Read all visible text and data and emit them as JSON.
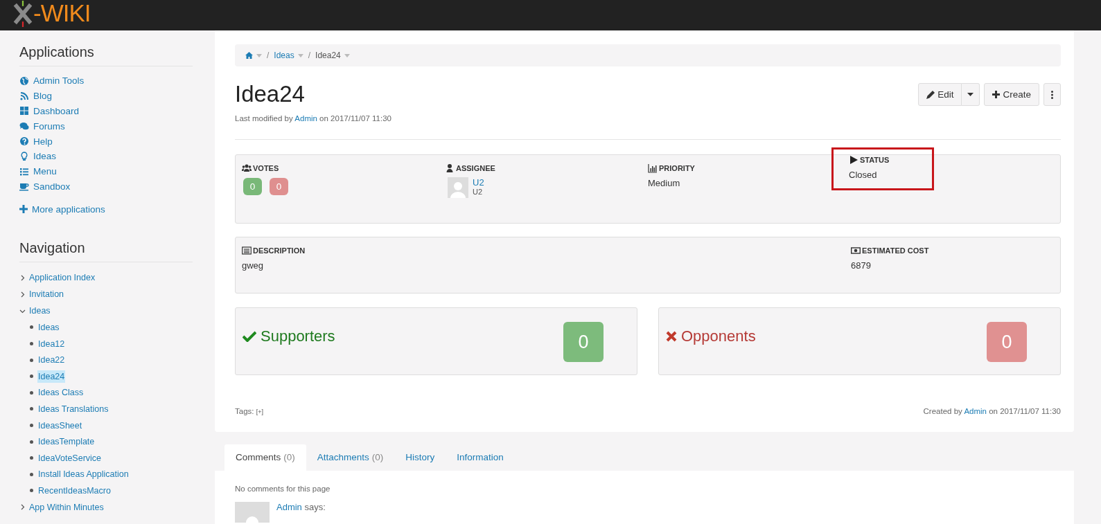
{
  "logo": {
    "text": "-WIKI"
  },
  "sidebar": {
    "applications": {
      "title": "Applications",
      "items": [
        {
          "label": "Admin Tools"
        },
        {
          "label": "Blog"
        },
        {
          "label": "Dashboard"
        },
        {
          "label": "Forums"
        },
        {
          "label": "Help"
        },
        {
          "label": "Ideas"
        },
        {
          "label": "Menu"
        },
        {
          "label": "Sandbox"
        }
      ],
      "more": "More applications"
    },
    "navigation": {
      "title": "Navigation",
      "items": [
        {
          "label": "Application Index",
          "expanded": false
        },
        {
          "label": "Invitation",
          "expanded": false
        },
        {
          "label": "Ideas",
          "expanded": true,
          "children": [
            {
              "label": "Ideas",
              "selected": false
            },
            {
              "label": "Idea12",
              "selected": false
            },
            {
              "label": "Idea22",
              "selected": false
            },
            {
              "label": "Idea24",
              "selected": true
            },
            {
              "label": "Ideas Class",
              "selected": false
            },
            {
              "label": "Ideas Translations",
              "selected": false
            },
            {
              "label": "IdeasSheet",
              "selected": false
            },
            {
              "label": "IdeasTemplate",
              "selected": false
            },
            {
              "label": "IdeaVoteService",
              "selected": false
            },
            {
              "label": "Install Ideas Application",
              "selected": false
            },
            {
              "label": "RecentIdeasMacro",
              "selected": false
            }
          ]
        },
        {
          "label": "App Within Minutes",
          "expanded": false
        }
      ]
    }
  },
  "breadcrumb": [
    {
      "separator": "/",
      "label": "Ideas",
      "kind": "link"
    },
    {
      "separator": "/",
      "label": "Idea24",
      "kind": "current"
    }
  ],
  "title": "Idea24",
  "modified": {
    "prefix": "Last modified by",
    "user": "Admin",
    "suffix": "on 2017/11/07 11:30"
  },
  "actions": {
    "edit": "Edit",
    "create": "Create"
  },
  "fields": [
    {
      "label": "VOTES",
      "kind": "votes",
      "up": "0",
      "down": "0",
      "highlighted": false
    },
    {
      "label": "ASSIGNEE",
      "kind": "user",
      "value": "U2",
      "sub": "U2",
      "highlighted": false
    },
    {
      "label": "PRIORITY",
      "kind": "text",
      "value": "Medium",
      "highlighted": false
    },
    {
      "label": "STATUS",
      "kind": "text",
      "value": "Closed",
      "highlighted": true
    }
  ],
  "details": [
    {
      "label": "DESCRIPTION",
      "kind": "wide",
      "value": "gweg"
    },
    {
      "label": "ESTIMATED COST",
      "kind": "narrow",
      "value": "6879"
    }
  ],
  "tallies": [
    {
      "label": "Supporters",
      "kind": "support",
      "count": "0"
    },
    {
      "label": "Opponents",
      "kind": "oppose",
      "count": "0"
    }
  ],
  "tags": {
    "label": "Tags:",
    "add": "[+]"
  },
  "created": {
    "prefix": "Created by",
    "user": "Admin",
    "suffix": "on 2017/11/07 11:30"
  },
  "tabs": [
    {
      "label": "Comments",
      "count": "(0)",
      "selected": true
    },
    {
      "label": "Attachments",
      "count": "(0)",
      "selected": false
    },
    {
      "label": "History",
      "selected": false
    },
    {
      "label": "Information",
      "selected": false
    }
  ],
  "comments": {
    "empty": "No comments for this page",
    "author": "Admin",
    "says": "says:"
  }
}
